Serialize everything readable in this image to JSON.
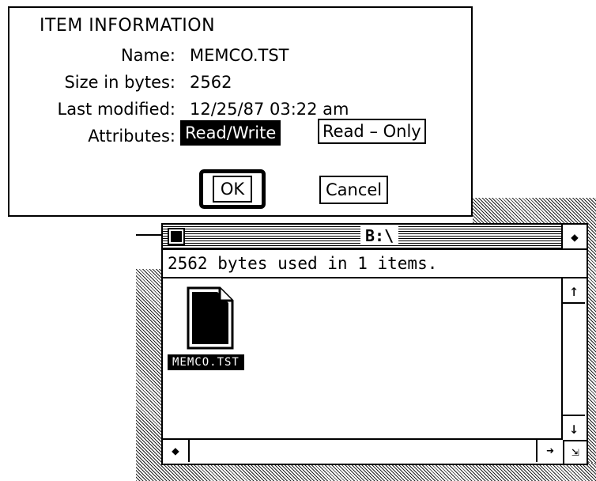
{
  "dialog": {
    "title": "ITEM INFORMATION",
    "name_label": "Name:",
    "name_value": "MEMCO.TST",
    "size_label": "Size in bytes:",
    "size_value": "2562",
    "modified_label": "Last modified:",
    "modified_value": "12/25/87 03:22 am",
    "attributes_label": "Attributes:",
    "attr_readwrite": "Read/Write",
    "attr_readonly": "Read – Only",
    "selected_attribute": "Read/Write",
    "ok_label": "OK",
    "cancel_label": "Cancel"
  },
  "window": {
    "title": "B:\\",
    "info": "2562 bytes used in 1 items.",
    "files": [
      {
        "name": "MEMCO.TST",
        "selected": true
      }
    ]
  },
  "icons": {
    "close": "close-box-icon",
    "fuller": "fuller-icon",
    "up": "up-arrow-icon",
    "down": "down-arrow-icon",
    "left": "left-arrow-icon",
    "right": "right-arrow-icon",
    "sizer": "sizer-icon",
    "document": "document-icon"
  }
}
